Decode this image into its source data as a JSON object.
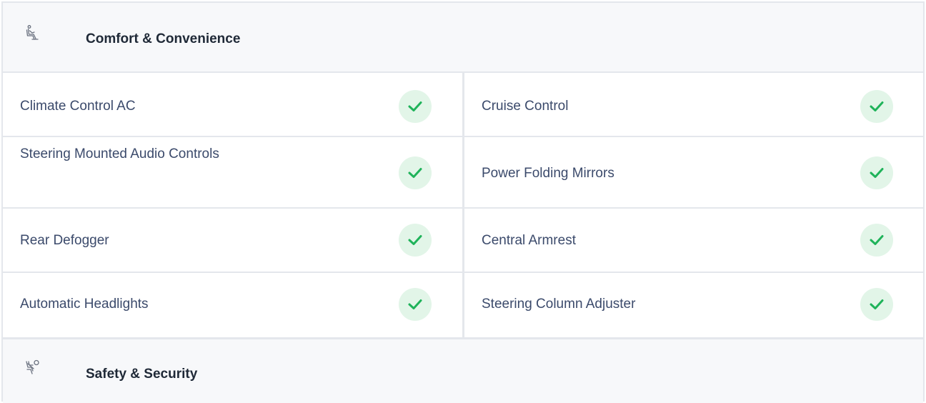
{
  "sections": [
    {
      "title": "Comfort & Convenience",
      "icon": "seat-icon"
    },
    {
      "title": "Safety & Security",
      "icon": "seatbelt-passenger-icon"
    }
  ],
  "features": {
    "left": [
      {
        "label": "Climate Control AC",
        "available": true
      },
      {
        "label": "Steering Mounted Audio Controls",
        "available": true
      },
      {
        "label": "Rear Defogger",
        "available": true
      },
      {
        "label": "Automatic Headlights",
        "available": true
      }
    ],
    "right": [
      {
        "label": "Cruise Control",
        "available": true
      },
      {
        "label": "Power Folding Mirrors",
        "available": true
      },
      {
        "label": "Central Armrest",
        "available": true
      },
      {
        "label": "Steering Column Adjuster",
        "available": true
      }
    ]
  },
  "colors": {
    "check_bg": "#e2f5e8",
    "check_mark": "#1fb35a",
    "border": "#e4e7ec"
  }
}
